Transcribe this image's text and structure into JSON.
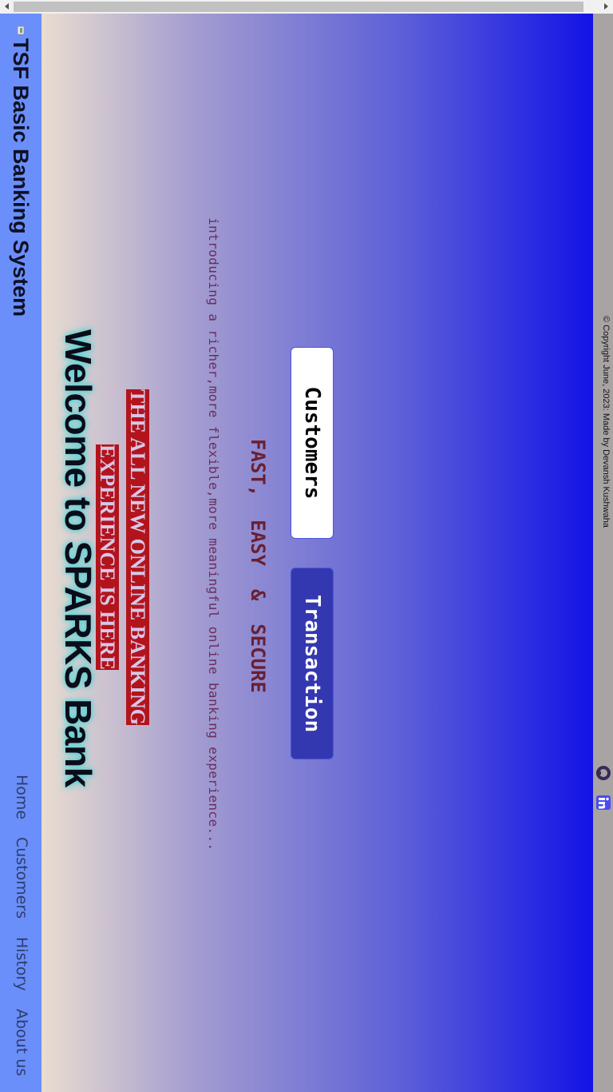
{
  "brand": {
    "title": "TSF Basic Banking System"
  },
  "nav": {
    "items": [
      "Home",
      "Customers",
      "History",
      "About us"
    ]
  },
  "hero": {
    "welcome": "Welcome to SPARKS Bank",
    "headline_line1": "THE ALL NEW ONLINE BANKING",
    "headline_line2": "EXPERIENCE IS HERE",
    "intro": "introducing a richer,more flexible,more meaningful online banking experience...",
    "tagline": "FAST,  EASY  &  SECURE",
    "buttons": {
      "customers": "Customers",
      "transaction": "Transaction"
    }
  },
  "footer": {
    "copyright": "© Copyright June, 2023: Made by Devansh Kushwaha"
  },
  "colors": {
    "navbar": "#6a8ffb",
    "headline_bg": "#b3141c",
    "transaction_btn": "#3438b0",
    "footer": "#a8a4a4"
  },
  "icons": {
    "linkedin": "linkedin-icon",
    "github": "github-icon",
    "brand": "bank-logo-icon"
  }
}
